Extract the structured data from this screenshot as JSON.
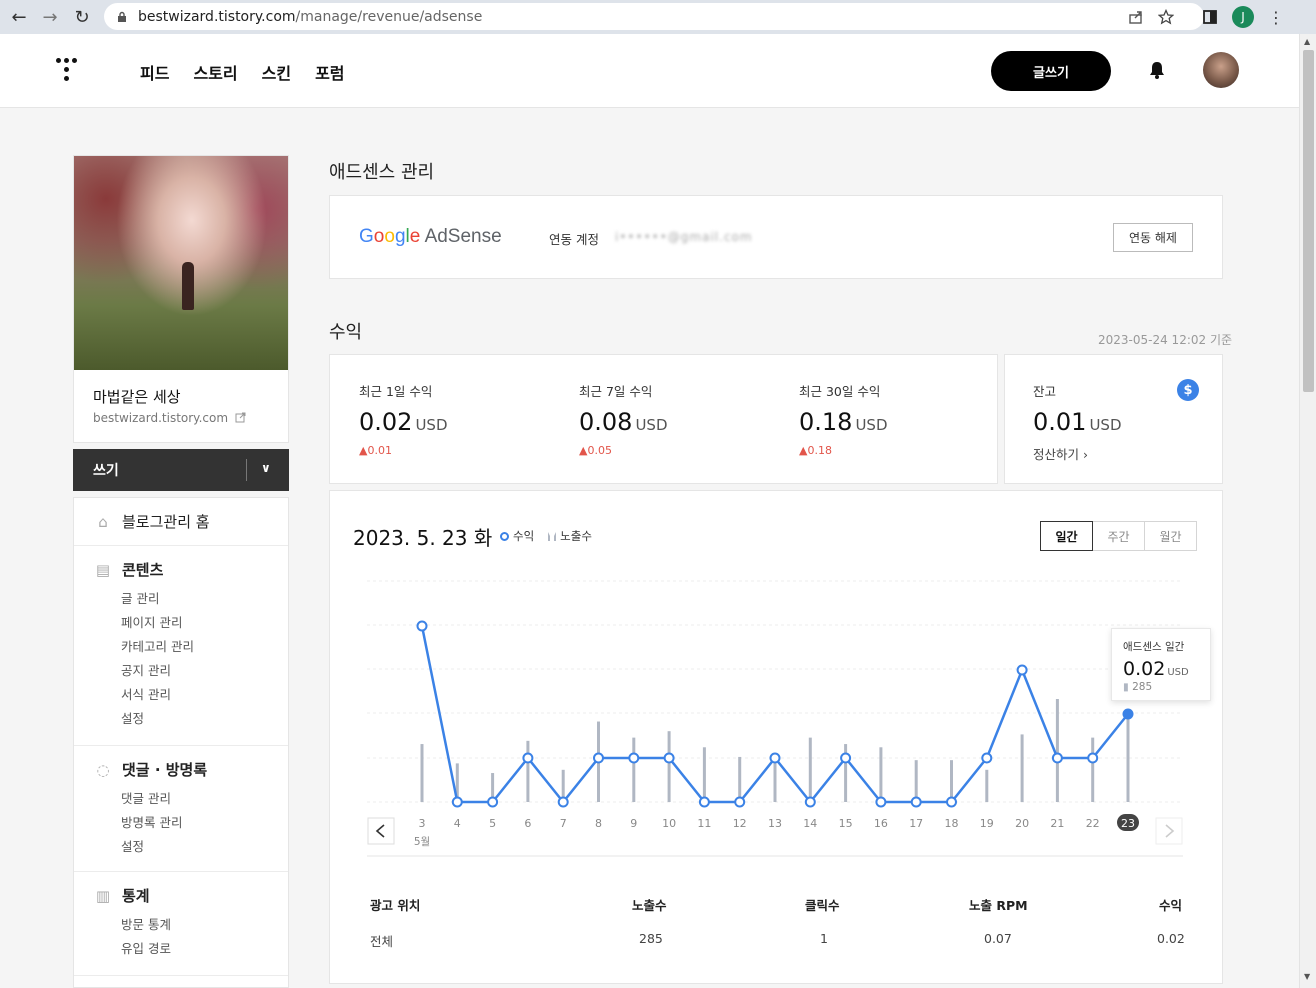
{
  "browser": {
    "url_domain": "bestwizard.tistory.com",
    "url_path": "/manage/revenue/adsense",
    "profile_initial": "J"
  },
  "topnav": {
    "items": [
      "피드",
      "스토리",
      "스킨",
      "포럼"
    ],
    "write_label": "글쓰기"
  },
  "sidebar": {
    "blog_name": "마법같은 세상",
    "blog_url": "bestwizard.tistory.com",
    "write_label": "쓰기",
    "home_label": "블로그관리 홈",
    "sections": [
      {
        "title": "콘텐츠",
        "items": [
          "글 관리",
          "페이지 관리",
          "카테고리 관리",
          "공지 관리",
          "서식 관리",
          "설정"
        ]
      },
      {
        "title": "댓글 · 방명록",
        "items": [
          "댓글 관리",
          "방명록 관리",
          "설정"
        ]
      },
      {
        "title": "통계",
        "items": [
          "방문 통계",
          "유입 경로"
        ]
      }
    ]
  },
  "main": {
    "page_title": "애드센스 관리",
    "adsense": {
      "logo_google": "Google",
      "logo_adsense": "AdSense",
      "link_label": "연동 계정",
      "link_email": "i••••••@gmail.com",
      "unlink_label": "연동 해제"
    },
    "revenue_title": "수익",
    "revenue_time": "2023-05-24 12:02 기준",
    "stats": [
      {
        "label": "최근 1일 수익",
        "value": "0.02",
        "unit": "USD",
        "change": "0.01"
      },
      {
        "label": "최근 7일 수익",
        "value": "0.08",
        "unit": "USD",
        "change": "0.05"
      },
      {
        "label": "최근 30일 수익",
        "value": "0.18",
        "unit": "USD",
        "change": "0.18"
      }
    ],
    "balance": {
      "label": "잔고",
      "value": "0.01",
      "unit": "USD",
      "settle_label": "정산하기"
    },
    "chart_header": {
      "date": "2023. 5. 23 화",
      "legend_revenue": "수익",
      "legend_impressions": "노출수",
      "tabs": [
        "일간",
        "주간",
        "월간"
      ],
      "active_tab": "일간"
    },
    "tooltip": {
      "title": "애드센스 일간",
      "value": "0.02",
      "unit": "USD",
      "impressions": "285"
    },
    "table": {
      "headers": [
        "광고 위치",
        "노출수",
        "클릭수",
        "노출 RPM",
        "수익"
      ],
      "rows": [
        [
          "전체",
          "285",
          "1",
          "0.07",
          "0.02"
        ]
      ]
    }
  },
  "chart_data": {
    "type": "line",
    "x": [
      "3",
      "4",
      "5",
      "6",
      "7",
      "8",
      "9",
      "10",
      "11",
      "12",
      "13",
      "14",
      "15",
      "16",
      "17",
      "18",
      "19",
      "20",
      "21",
      "22",
      "23"
    ],
    "x_sublabel": "5월",
    "series": [
      {
        "name": "수익",
        "type": "line",
        "color": "#3b82e6",
        "values": [
          0.04,
          0,
          0,
          0.01,
          0,
          0.01,
          0.01,
          0.01,
          0,
          0,
          0.01,
          0,
          0.01,
          0,
          0,
          0,
          0.01,
          0.03,
          0.01,
          0.01,
          0.02
        ]
      },
      {
        "name": "노출수",
        "type": "bar",
        "color": "#b0b7c3",
        "values": [
          180,
          120,
          90,
          190,
          100,
          250,
          200,
          220,
          170,
          140,
          130,
          200,
          180,
          170,
          130,
          130,
          100,
          210,
          320,
          200,
          285
        ]
      }
    ],
    "highlight_index": 20
  }
}
